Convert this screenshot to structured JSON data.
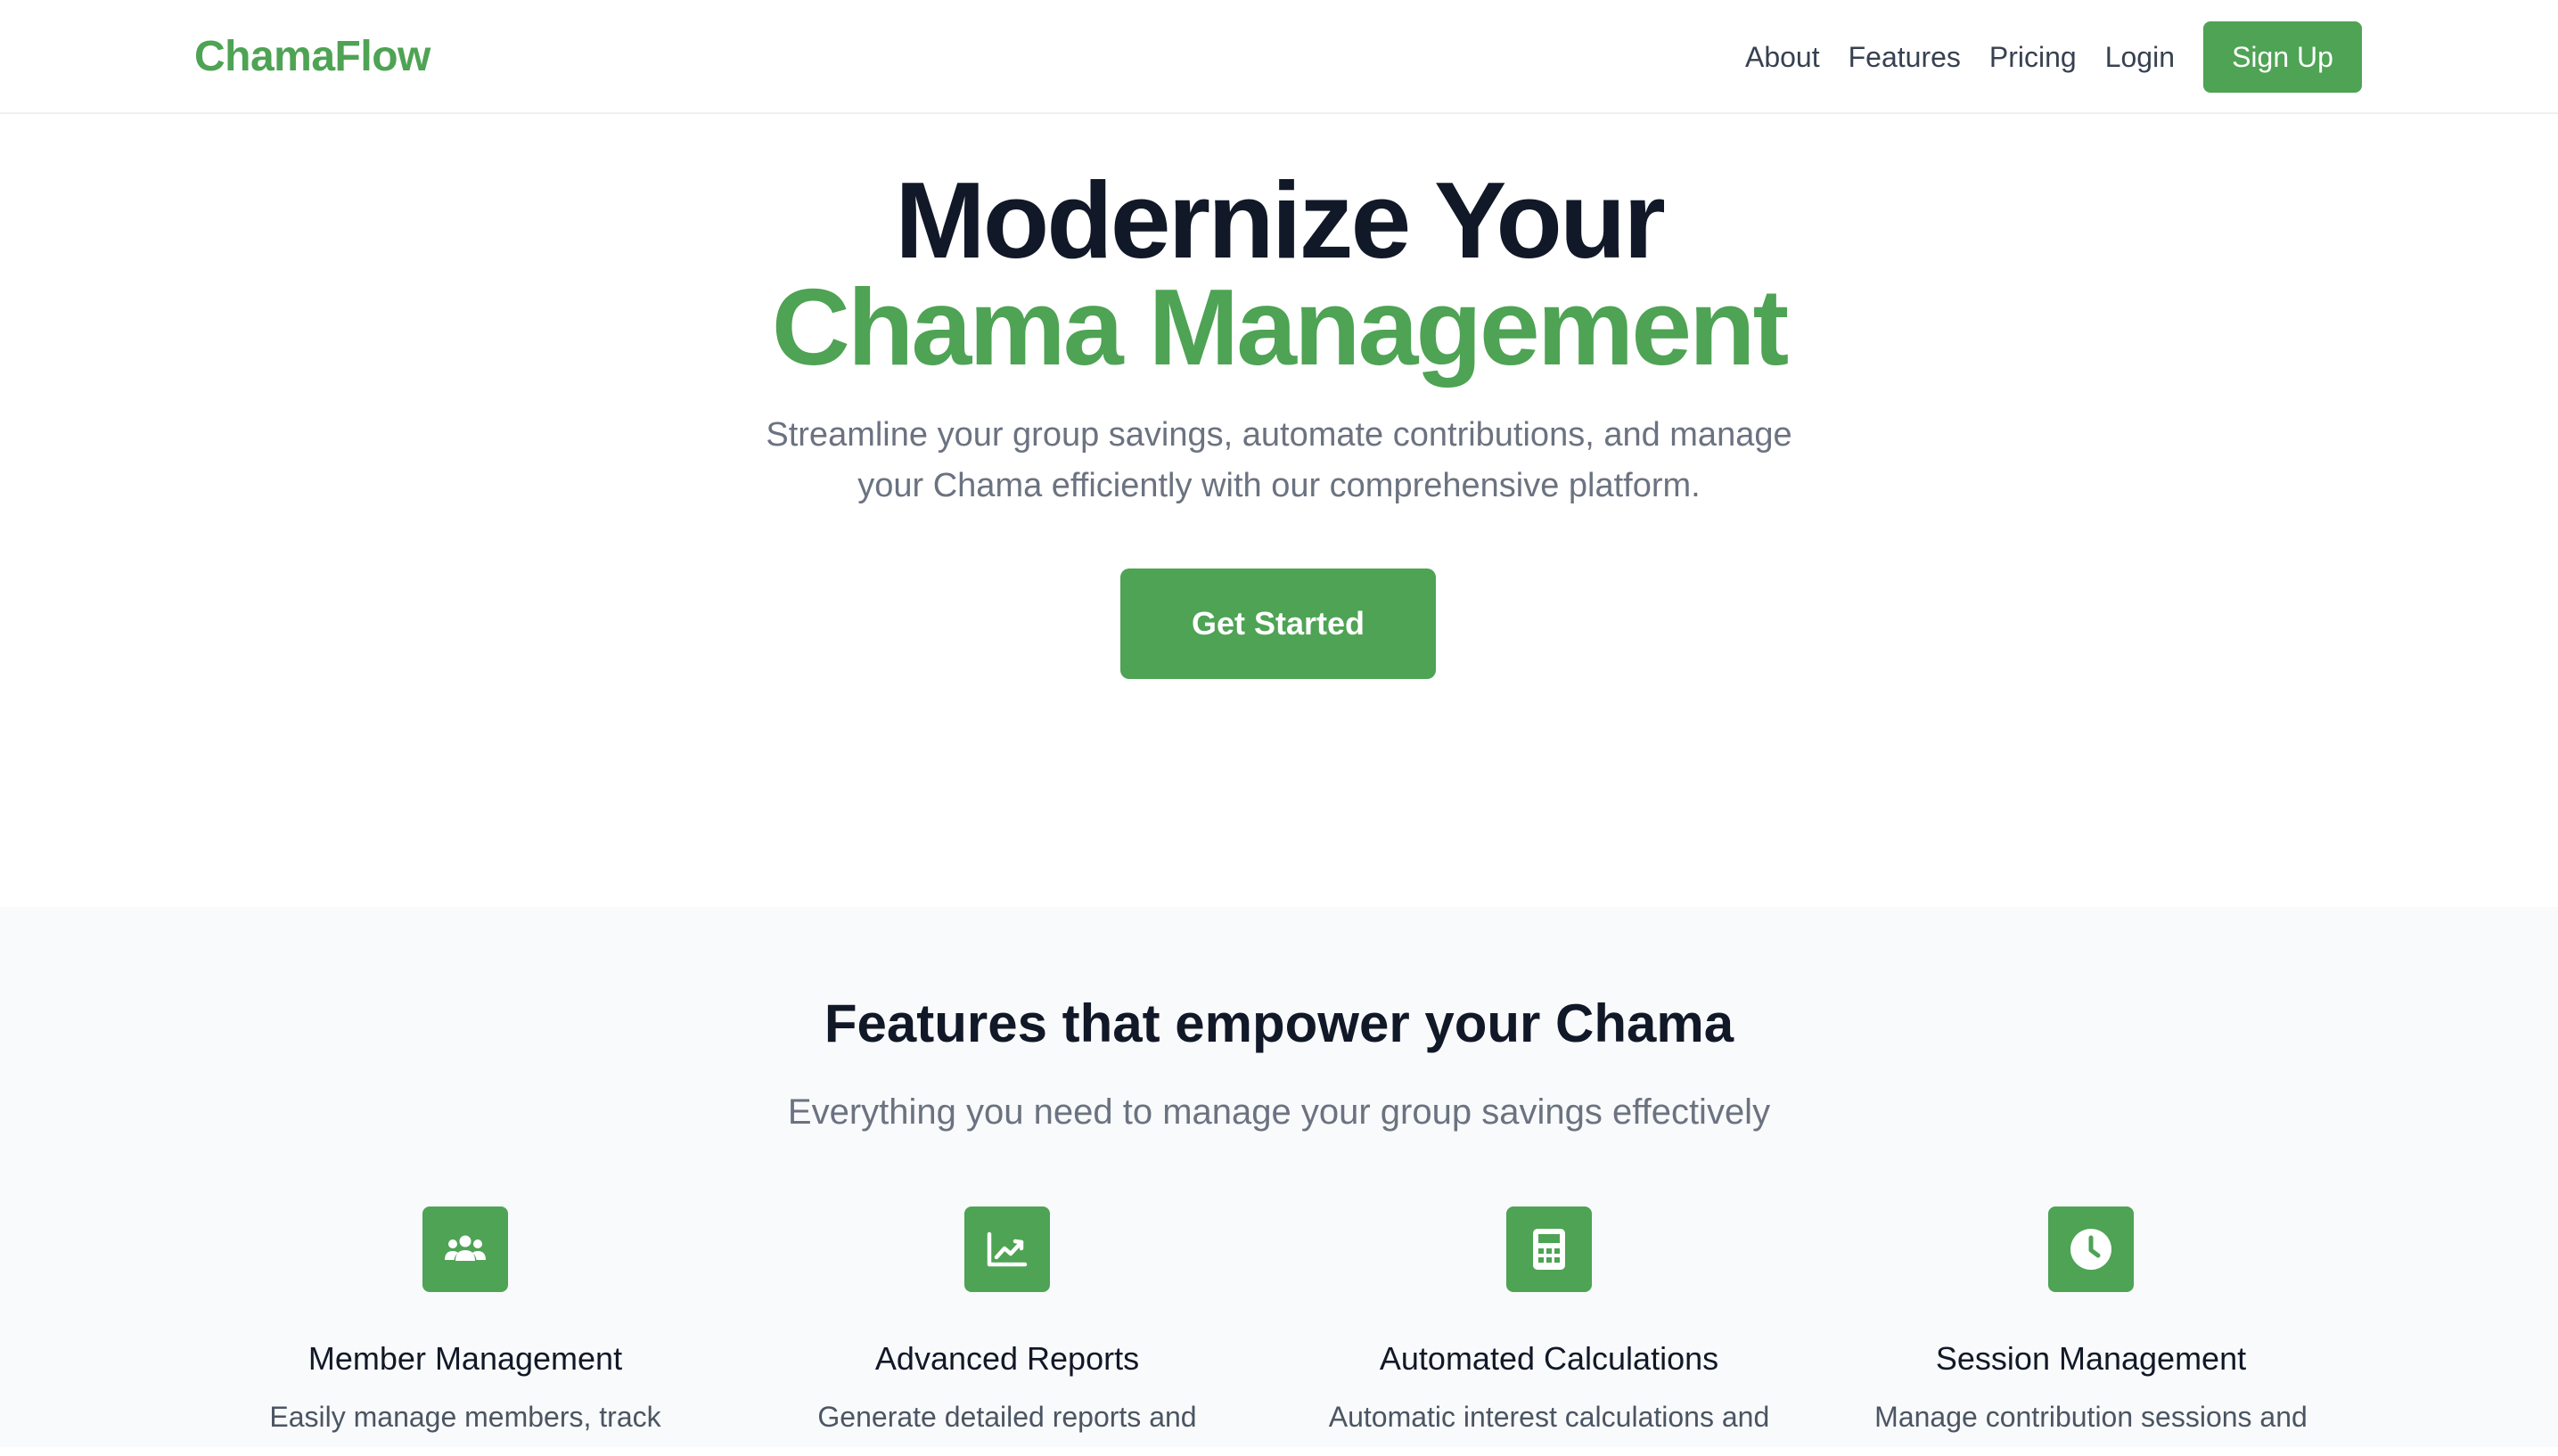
{
  "nav": {
    "brand": "ChamaFlow",
    "links": [
      "About",
      "Features",
      "Pricing",
      "Login"
    ],
    "signup_label": "Sign Up"
  },
  "hero": {
    "title_line1": "Modernize Your",
    "title_line2": "Chama Management",
    "subtitle": "Streamline your group savings, automate contributions, and manage your Chama efficiently with our comprehensive platform.",
    "cta_label": "Get Started"
  },
  "features": {
    "title": "Features that empower your Chama",
    "subtitle": "Everything you need to manage your group savings effectively",
    "items": [
      {
        "icon": "users-icon",
        "name": "Member Management",
        "desc": "Easily manage members, track"
      },
      {
        "icon": "chart-line-icon",
        "name": "Advanced Reports",
        "desc": "Generate detailed reports and"
      },
      {
        "icon": "calculator-icon",
        "name": "Automated Calculations",
        "desc": "Automatic interest calculations and"
      },
      {
        "icon": "clock-icon",
        "name": "Session Management",
        "desc": "Manage contribution sessions and"
      }
    ]
  },
  "colors": {
    "brand_green": "#4ea354",
    "heading_dark": "#111827",
    "muted_text": "#6b7280",
    "section_bg": "#f9fafb"
  }
}
